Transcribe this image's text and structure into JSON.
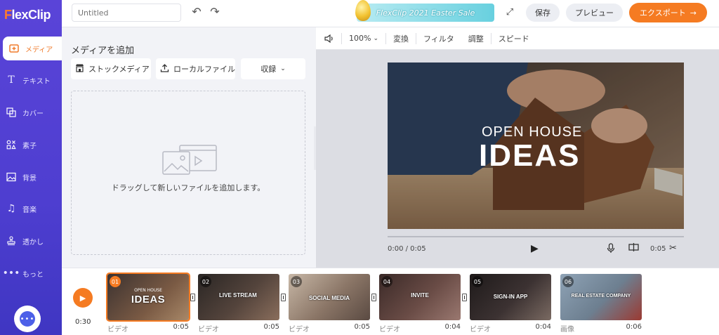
{
  "app": {
    "logo": "FlexClip",
    "logo_mark": "F"
  },
  "sidebar": {
    "items": [
      {
        "label": "メディア",
        "icon": "media-plus-icon",
        "active": true
      },
      {
        "label": "テキスト",
        "icon": "text-icon"
      },
      {
        "label": "カバー",
        "icon": "cover-icon"
      },
      {
        "label": "素子",
        "icon": "elements-icon"
      },
      {
        "label": "背景",
        "icon": "background-icon"
      },
      {
        "label": "音楽",
        "icon": "music-icon"
      },
      {
        "label": "透かし",
        "icon": "watermark-icon"
      },
      {
        "label": "もっと",
        "icon": "more-icon"
      }
    ],
    "chat_icon": "chat-bubble-icon"
  },
  "topbar": {
    "title_placeholder": "Untitled",
    "promo_text": "FlexClip 2021 Easter Sale",
    "save_label": "保存",
    "preview_label": "プレビュー",
    "export_label": "エクスポート",
    "export_arrow": "→"
  },
  "media_panel": {
    "title": "メディアを追加",
    "stock_label": "ストックメディア",
    "local_label": "ローカルファイル",
    "record_label": "収録",
    "drop_text": "ドラッグして新しいファイルを追加します。"
  },
  "preview": {
    "toolbar": {
      "zoom": "100%",
      "transition": "変換",
      "filter": "フィルタ",
      "adjust": "調整",
      "speed": "スピード"
    },
    "video_title_top": "OPEN HOUSE",
    "video_title_main": "IDEAS",
    "time_current": "0:00 / 0:05",
    "clip_duration": "0:05"
  },
  "timeline": {
    "total_time": "0:30",
    "clips": [
      {
        "num": "01",
        "caption": "IDEAS",
        "sub": "OPEN HOUSE",
        "type": "ビデオ",
        "duration": "0:05",
        "active": true
      },
      {
        "num": "02",
        "caption": "LIVE STREAM",
        "sub": "",
        "type": "ビデオ",
        "duration": "0:05"
      },
      {
        "num": "03",
        "caption": "SOCIAL MEDIA",
        "sub": "",
        "type": "ビデオ",
        "duration": "0:05"
      },
      {
        "num": "04",
        "caption": "INVITE",
        "sub": "",
        "type": "ビデオ",
        "duration": "0:04"
      },
      {
        "num": "05",
        "caption": "SIGN-IN APP",
        "sub": "",
        "type": "ビデオ",
        "duration": "0:04"
      },
      {
        "num": "06",
        "caption": "REAL ESTATE COMPANY",
        "sub": "",
        "type": "画像",
        "duration": "0:06"
      }
    ]
  },
  "colors": {
    "accent": "#f57b22",
    "sidebar": "#5a44d8",
    "promo": "#68d0df"
  }
}
